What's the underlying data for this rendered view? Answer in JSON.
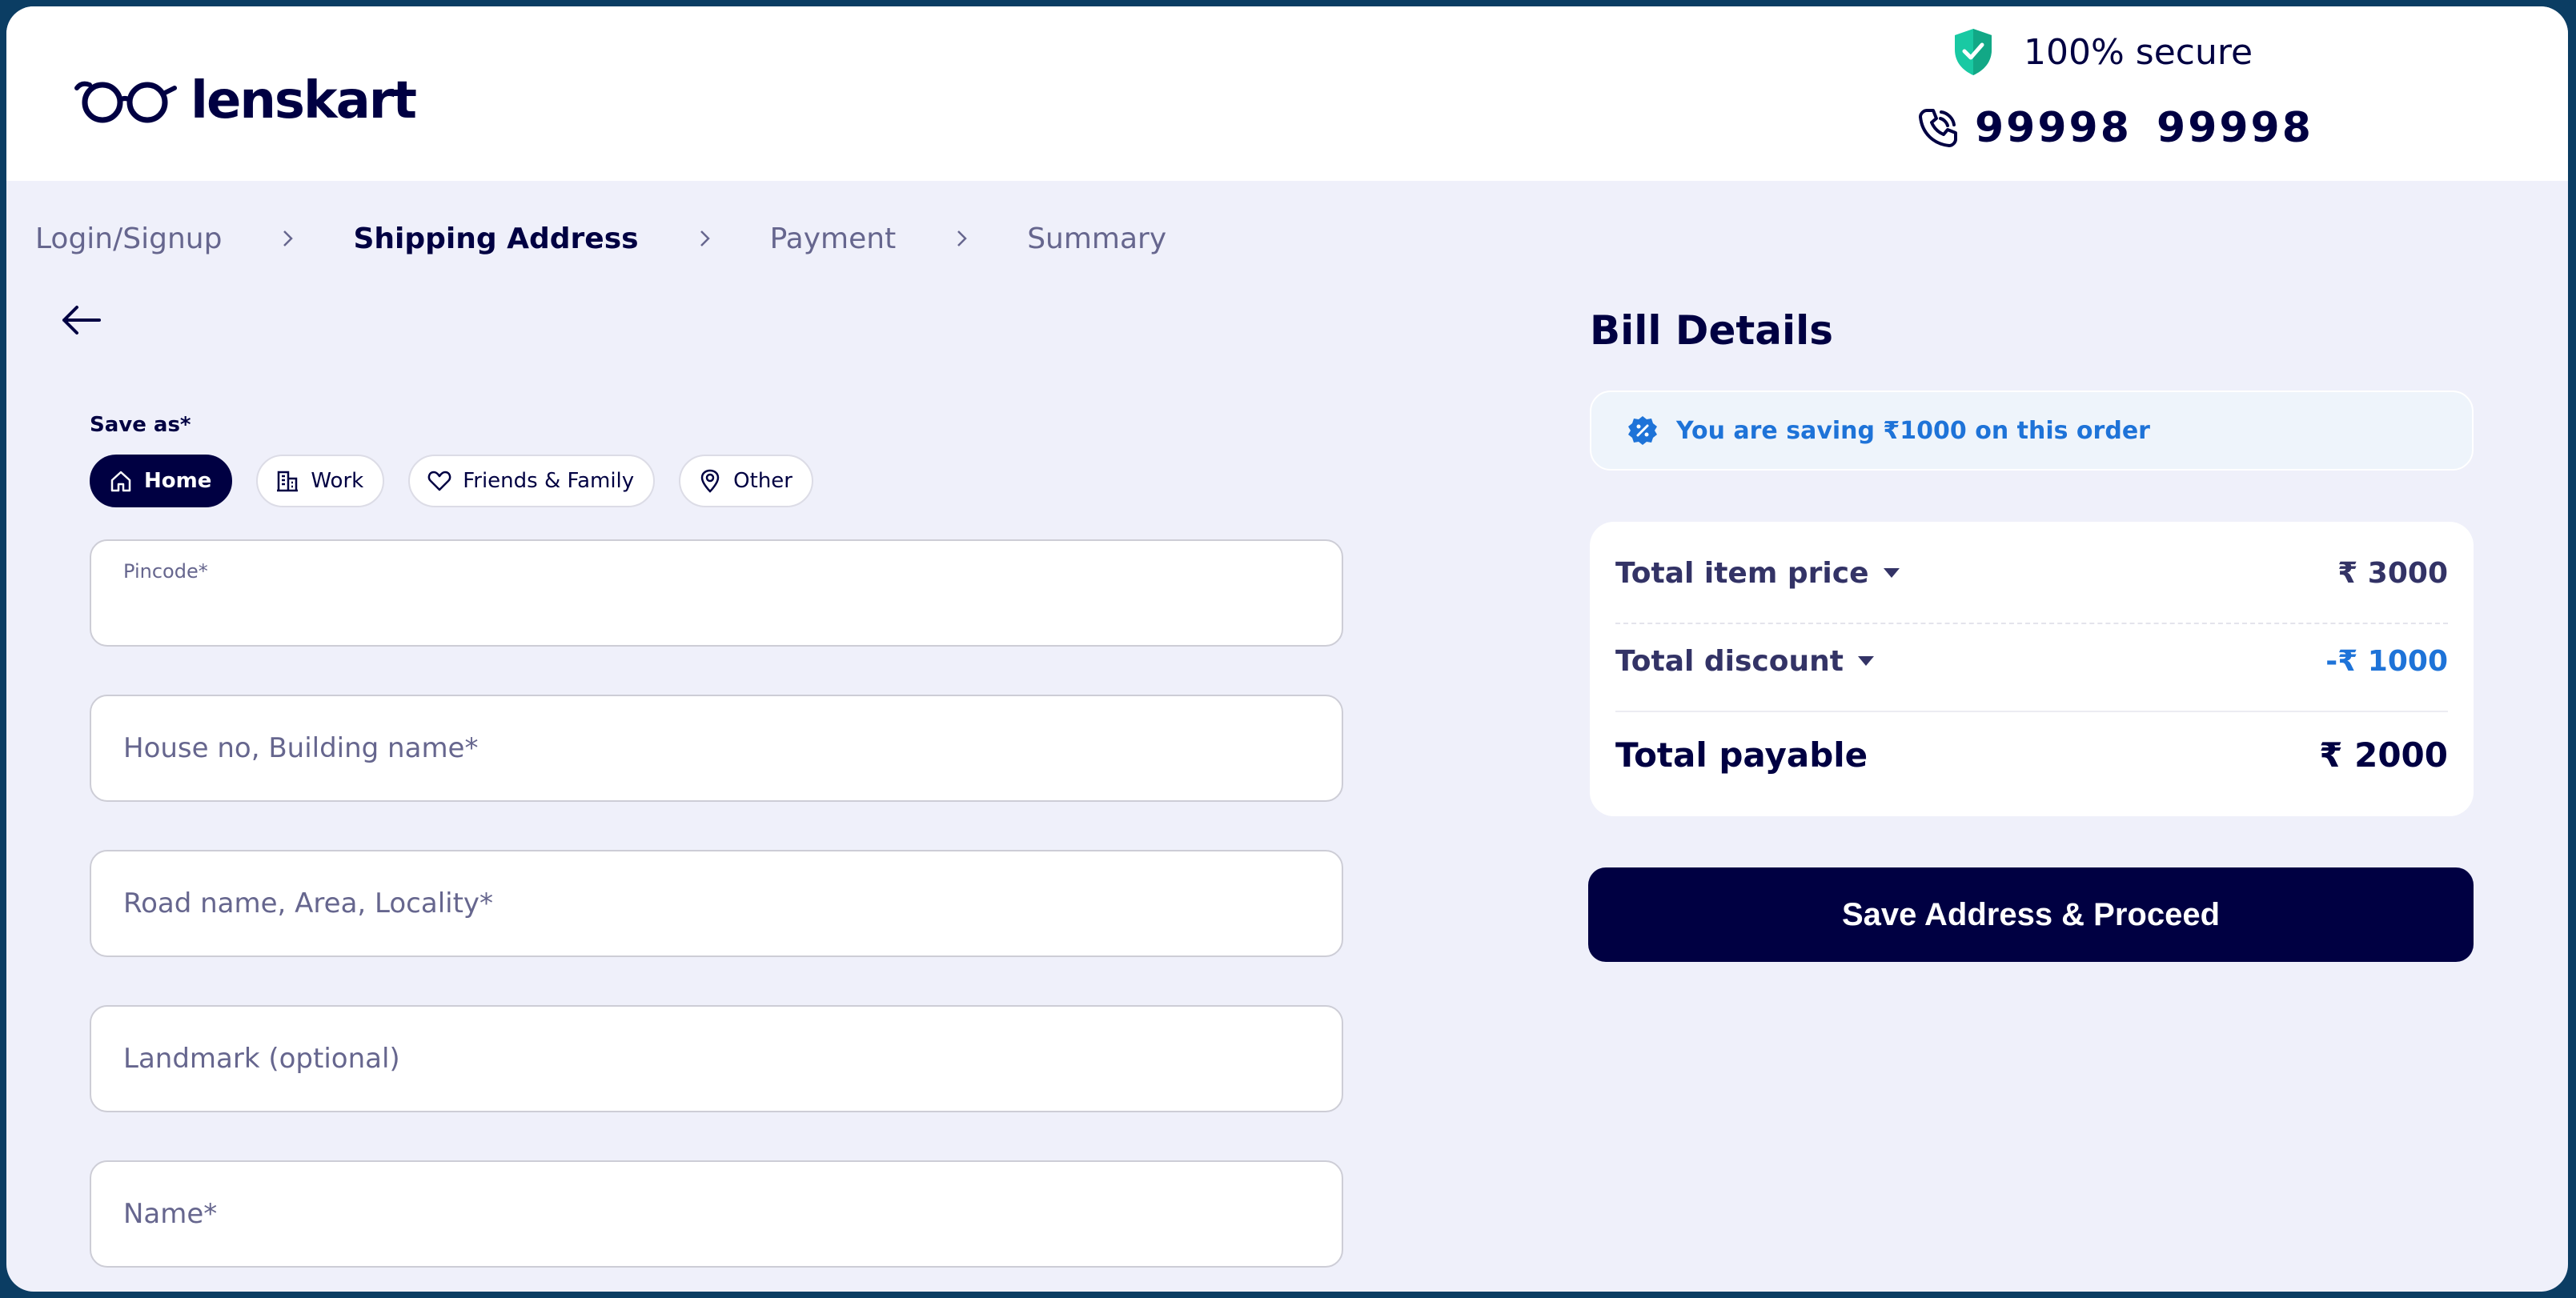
{
  "header": {
    "brand": "lenskart",
    "secure_text": "100% secure",
    "phone": "99998  99998"
  },
  "breadcrumb": [
    {
      "label": "Login/Signup",
      "active": false
    },
    {
      "label": "Shipping Address",
      "active": true
    },
    {
      "label": "Payment",
      "active": false
    },
    {
      "label": "Summary",
      "active": false
    }
  ],
  "address_form": {
    "save_as_label": "Save as*",
    "chips": [
      {
        "label": "Home",
        "icon": "home-icon",
        "selected": true
      },
      {
        "label": "Work",
        "icon": "building-icon",
        "selected": false
      },
      {
        "label": "Friends & Family",
        "icon": "heart-icon",
        "selected": false
      },
      {
        "label": "Other",
        "icon": "location-pin-icon",
        "selected": false
      }
    ],
    "fields": {
      "pincode": {
        "label": "Pincode*",
        "value": ""
      },
      "house": {
        "placeholder": "House no, Building name*",
        "value": ""
      },
      "road": {
        "placeholder": "Road name, Area, Locality*",
        "value": ""
      },
      "landmark": {
        "placeholder": "Landmark (optional)",
        "value": ""
      },
      "name": {
        "placeholder": "Name*",
        "value": ""
      }
    }
  },
  "bill": {
    "title": "Bill Details",
    "saving_text": "You are saving ₹1000 on this order",
    "item_price_label": "Total item price",
    "item_price_value": "₹ 3000",
    "discount_label": "Total discount",
    "discount_value": "-₹ 1000",
    "payable_label": "Total payable",
    "payable_value": "₹ 2000"
  },
  "actions": {
    "proceed_label": "Save Address & Proceed"
  },
  "colors": {
    "brand_navy": "#000042",
    "accent_blue": "#1e73d8",
    "secure_green": "#19c9a3",
    "page_bg": "#eff0fa"
  }
}
